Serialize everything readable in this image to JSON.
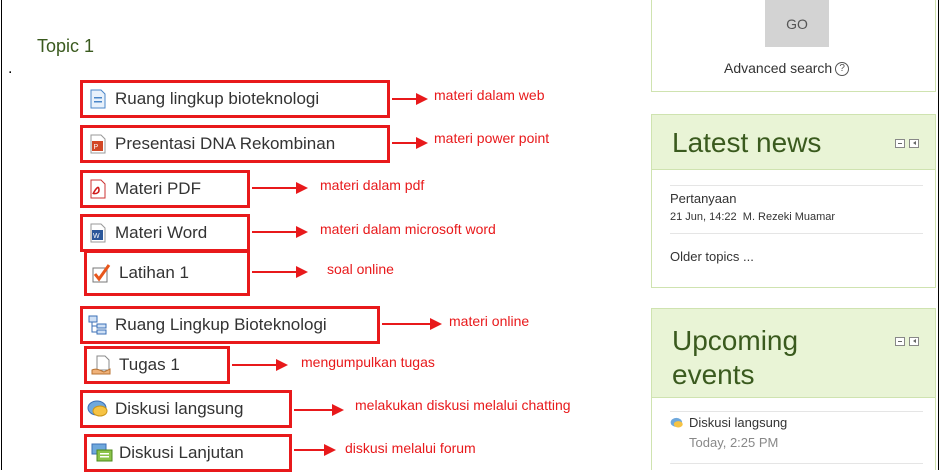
{
  "topic": {
    "title": "Topic 1",
    "dot": "."
  },
  "activities": [
    {
      "label": "Ruang lingkup bioteknologi",
      "icon": "web-page-icon",
      "note": "materi dalam web"
    },
    {
      "label": "Presentasi DNA Rekombinan",
      "icon": "powerpoint-icon",
      "note": "materi power point"
    },
    {
      "label": "Materi PDF",
      "icon": "pdf-icon",
      "note": "materi dalam pdf"
    },
    {
      "label": "Materi Word",
      "icon": "word-icon",
      "note": "materi dalam microsoft word"
    },
    {
      "label": "Latihan 1",
      "icon": "quiz-checkmark-icon",
      "note": "soal online"
    },
    {
      "label": "Ruang Lingkup Bioteknologi",
      "icon": "book-structure-icon",
      "note": "materi online"
    },
    {
      "label": "Tugas 1",
      "icon": "assignment-icon",
      "note": "mengumpulkan tugas"
    },
    {
      "label": "Diskusi langsung",
      "icon": "chat-icon",
      "note": "melakukan diskusi melalui chatting"
    },
    {
      "label": "Diskusi Lanjutan",
      "icon": "forum-icon",
      "note": "diskusi melalui forum"
    }
  ],
  "search": {
    "go_label": "GO",
    "advanced_label": "Advanced search",
    "help_glyph": "?"
  },
  "latest_news": {
    "title": "Latest news",
    "item_title": "Pertanyaan",
    "item_meta": "21 Jun, 14:22  M. Rezeki Muamar",
    "older": "Older topics ..."
  },
  "upcoming_events": {
    "title_line1": "Upcoming",
    "title_line2": "events",
    "event_name": "Diskusi langsung",
    "event_time": "Today, 2:25 PM"
  },
  "colors": {
    "annotation": "#e8191b",
    "block_header": "#e9f4d6",
    "title_green": "#3a5a1e"
  }
}
